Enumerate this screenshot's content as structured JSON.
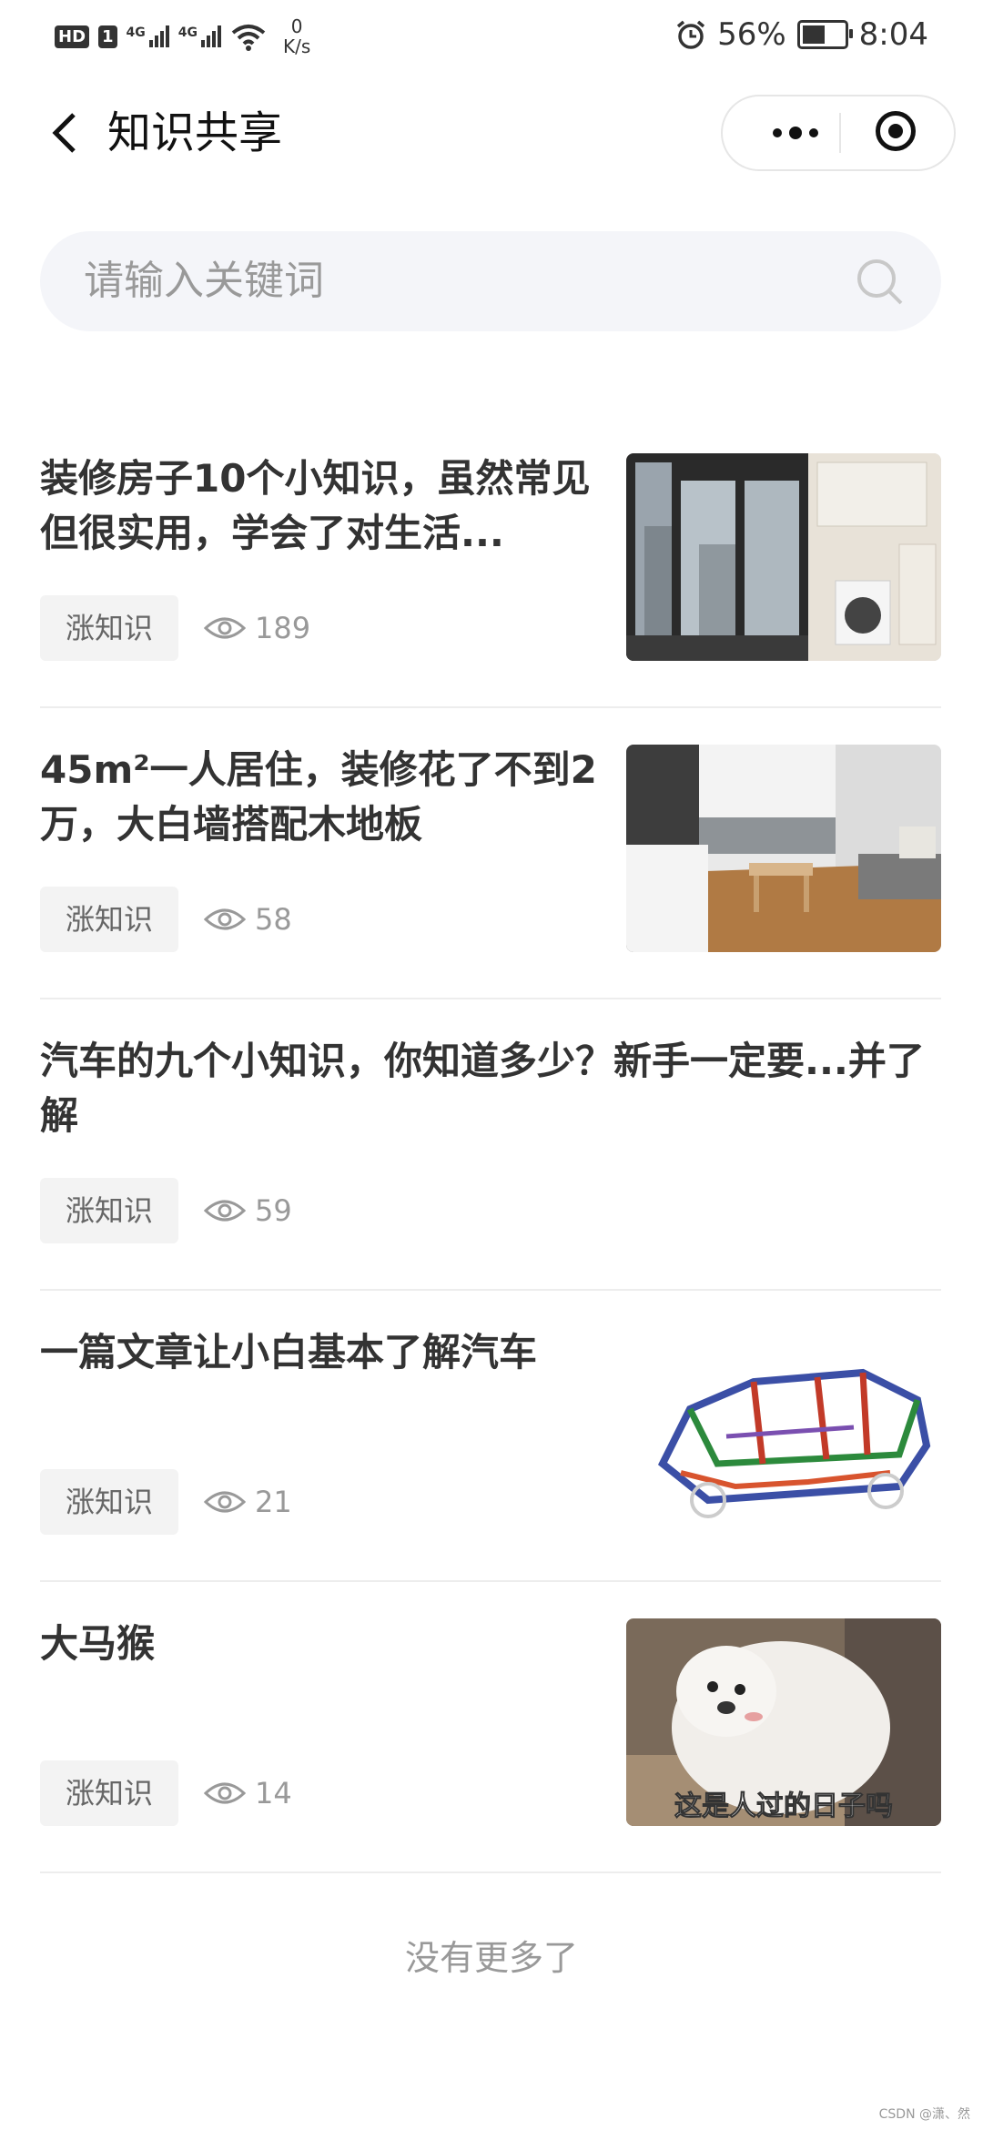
{
  "status_bar": {
    "hd": "HD",
    "sim1_slot": "1",
    "network1": "4G",
    "network2": "4G",
    "speed_value": "0",
    "speed_unit": "K/s",
    "battery": "56%",
    "battery_level": 0.56,
    "time": "8:04"
  },
  "nav": {
    "title": "知识共享"
  },
  "search": {
    "placeholder": "请输入关键词"
  },
  "articles": [
    {
      "title": "装修房子10个小知识，虽然常见但很实用，学会了对生活...",
      "tag": "涨知识",
      "views": "189",
      "thumb": "balcony-laundry-photo"
    },
    {
      "title": "45m²一人居住，装修花了不到2万，大白墙搭配木地板",
      "tag": "涨知识",
      "views": "58",
      "thumb": "room-wood-floor-photo"
    },
    {
      "title": "汽车的九个小知识，你知道多少？新手一定要...并了解",
      "tag": "涨知识",
      "views": "59",
      "thumb": null
    },
    {
      "title": "一篇文章让小白基本了解汽车",
      "tag": "涨知识",
      "views": "21",
      "thumb": "car-frame-illustration"
    },
    {
      "title": "大马猴",
      "tag": "涨知识",
      "views": "14",
      "thumb": "dog-meme-photo",
      "thumb_caption": "这是人过的日子吗"
    }
  ],
  "footer": {
    "no_more": "没有更多了"
  },
  "watermark": "CSDN @潇、然"
}
